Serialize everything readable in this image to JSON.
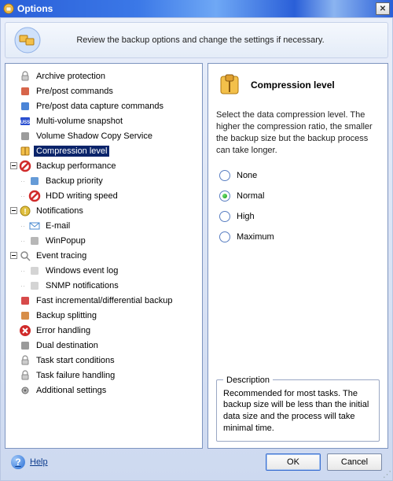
{
  "window": {
    "title": "Options",
    "close_glyph": "✕"
  },
  "banner": {
    "text": "Review the backup options and change the settings if necessary."
  },
  "tree": {
    "items": [
      {
        "id": "archive-protection",
        "label": "Archive protection",
        "level": 0,
        "expand": "",
        "icon": "lock"
      },
      {
        "id": "pre-post-commands",
        "label": "Pre/post commands",
        "level": 0,
        "expand": "",
        "icon": "cmd"
      },
      {
        "id": "pre-post-data-capture",
        "label": "Pre/post data capture commands",
        "level": 0,
        "expand": "",
        "icon": "cmd-blue"
      },
      {
        "id": "multi-volume-snapshot",
        "label": "Multi-volume snapshot",
        "level": 0,
        "expand": "",
        "icon": "vss"
      },
      {
        "id": "vss",
        "label": "Volume Shadow Copy Service",
        "level": 0,
        "expand": "",
        "icon": "shadow"
      },
      {
        "id": "compression-level",
        "label": "Compression level",
        "level": 0,
        "expand": "",
        "icon": "compress",
        "selected": true
      },
      {
        "id": "backup-performance",
        "label": "Backup performance",
        "level": 0,
        "expand": "minus",
        "icon": "deny"
      },
      {
        "id": "backup-priority",
        "label": "Backup priority",
        "level": 1,
        "expand": "",
        "icon": "priority"
      },
      {
        "id": "hdd-writing-speed",
        "label": "HDD writing speed",
        "level": 1,
        "expand": "",
        "icon": "deny"
      },
      {
        "id": "notifications",
        "label": "Notifications",
        "level": 0,
        "expand": "minus",
        "icon": "notify"
      },
      {
        "id": "email",
        "label": "E-mail",
        "level": 1,
        "expand": "",
        "icon": "mail"
      },
      {
        "id": "winpopup",
        "label": "WinPopup",
        "level": 1,
        "expand": "",
        "icon": "popup"
      },
      {
        "id": "event-tracing",
        "label": "Event tracing",
        "level": 0,
        "expand": "minus",
        "icon": "search"
      },
      {
        "id": "windows-event-log",
        "label": "Windows event log",
        "level": 1,
        "expand": "",
        "icon": "log"
      },
      {
        "id": "snmp-notifications",
        "label": "SNMP notifications",
        "level": 1,
        "expand": "",
        "icon": "snmp"
      },
      {
        "id": "fast-incremental",
        "label": "Fast incremental/differential backup",
        "level": 0,
        "expand": "",
        "icon": "fast"
      },
      {
        "id": "backup-splitting",
        "label": "Backup splitting",
        "level": 0,
        "expand": "",
        "icon": "split"
      },
      {
        "id": "error-handling",
        "label": "Error handling",
        "level": 0,
        "expand": "",
        "icon": "error"
      },
      {
        "id": "dual-destination",
        "label": "Dual destination",
        "level": 0,
        "expand": "",
        "icon": "dual"
      },
      {
        "id": "task-start-conditions",
        "label": "Task start conditions",
        "level": 0,
        "expand": "",
        "icon": "lock2"
      },
      {
        "id": "task-failure-handling",
        "label": "Task failure handling",
        "level": 0,
        "expand": "",
        "icon": "lock2"
      },
      {
        "id": "additional-settings",
        "label": "Additional settings",
        "level": 0,
        "expand": "",
        "icon": "gear"
      }
    ]
  },
  "detail": {
    "title": "Compression level",
    "text": "Select the data compression level. The higher the compression ratio, the smaller the backup size but the backup process can take longer.",
    "options": [
      {
        "id": "none",
        "label": "None",
        "selected": false
      },
      {
        "id": "normal",
        "label": "Normal",
        "selected": true
      },
      {
        "id": "high",
        "label": "High",
        "selected": false
      },
      {
        "id": "maximum",
        "label": "Maximum",
        "selected": false
      }
    ],
    "description_legend": "Description",
    "description_text": "Recommended for most tasks. The backup size will be less than the initial data size and the process will take minimal time."
  },
  "footer": {
    "help": "Help",
    "ok": "OK",
    "cancel": "Cancel"
  },
  "icons": {
    "lock": "#b8b8b8",
    "cmd": "#d04a2a",
    "cmd-blue": "#2a6fd0",
    "vss": "#2a4fd0",
    "shadow": "#8a8a8a",
    "compress": "#d8a030",
    "deny": "#d02a2a",
    "priority": "#4a8ad0",
    "notify": "#e0c040",
    "mail": "#4a8ad0",
    "popup": "#aaa",
    "search": "#888",
    "log": "#ccc",
    "snmp": "#ccc",
    "fast": "#d02a2a",
    "split": "#d07a2a",
    "error": "#d02a2a",
    "dual": "#888",
    "lock2": "#b8b8b8",
    "gear": "#888"
  }
}
